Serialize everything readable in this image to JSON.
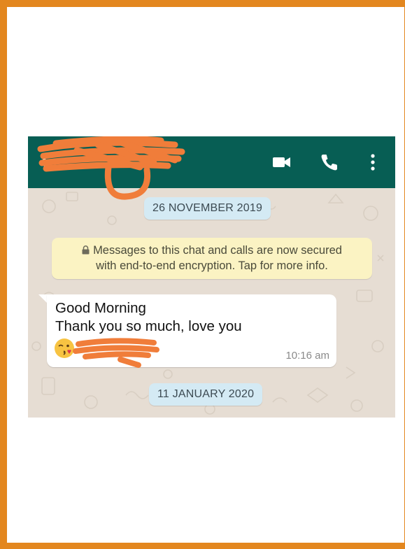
{
  "frame": {
    "border_color": "#e3871f"
  },
  "appbar": {
    "color": "#075e54",
    "back_icon": "arrow-back-icon",
    "actions": [
      {
        "name": "video-call",
        "icon": "video-camera-icon"
      },
      {
        "name": "voice-call",
        "icon": "phone-icon"
      },
      {
        "name": "more-options",
        "icon": "kebab-menu-icon"
      }
    ]
  },
  "chat": {
    "date_1": "26 NOVEMBER 2019",
    "encryption_notice_line1": "Messages to this chat and calls are now secured",
    "encryption_notice_line2": "with end-to-end encryption. Tap for more info.",
    "message": {
      "line1": "Good Morning",
      "line2": "Thank you so much, love you",
      "emoji": "face-blowing-a-kiss",
      "time": "10:16 am"
    },
    "date_2": "11 JANUARY 2020"
  },
  "redaction_color": "#f07d3a"
}
